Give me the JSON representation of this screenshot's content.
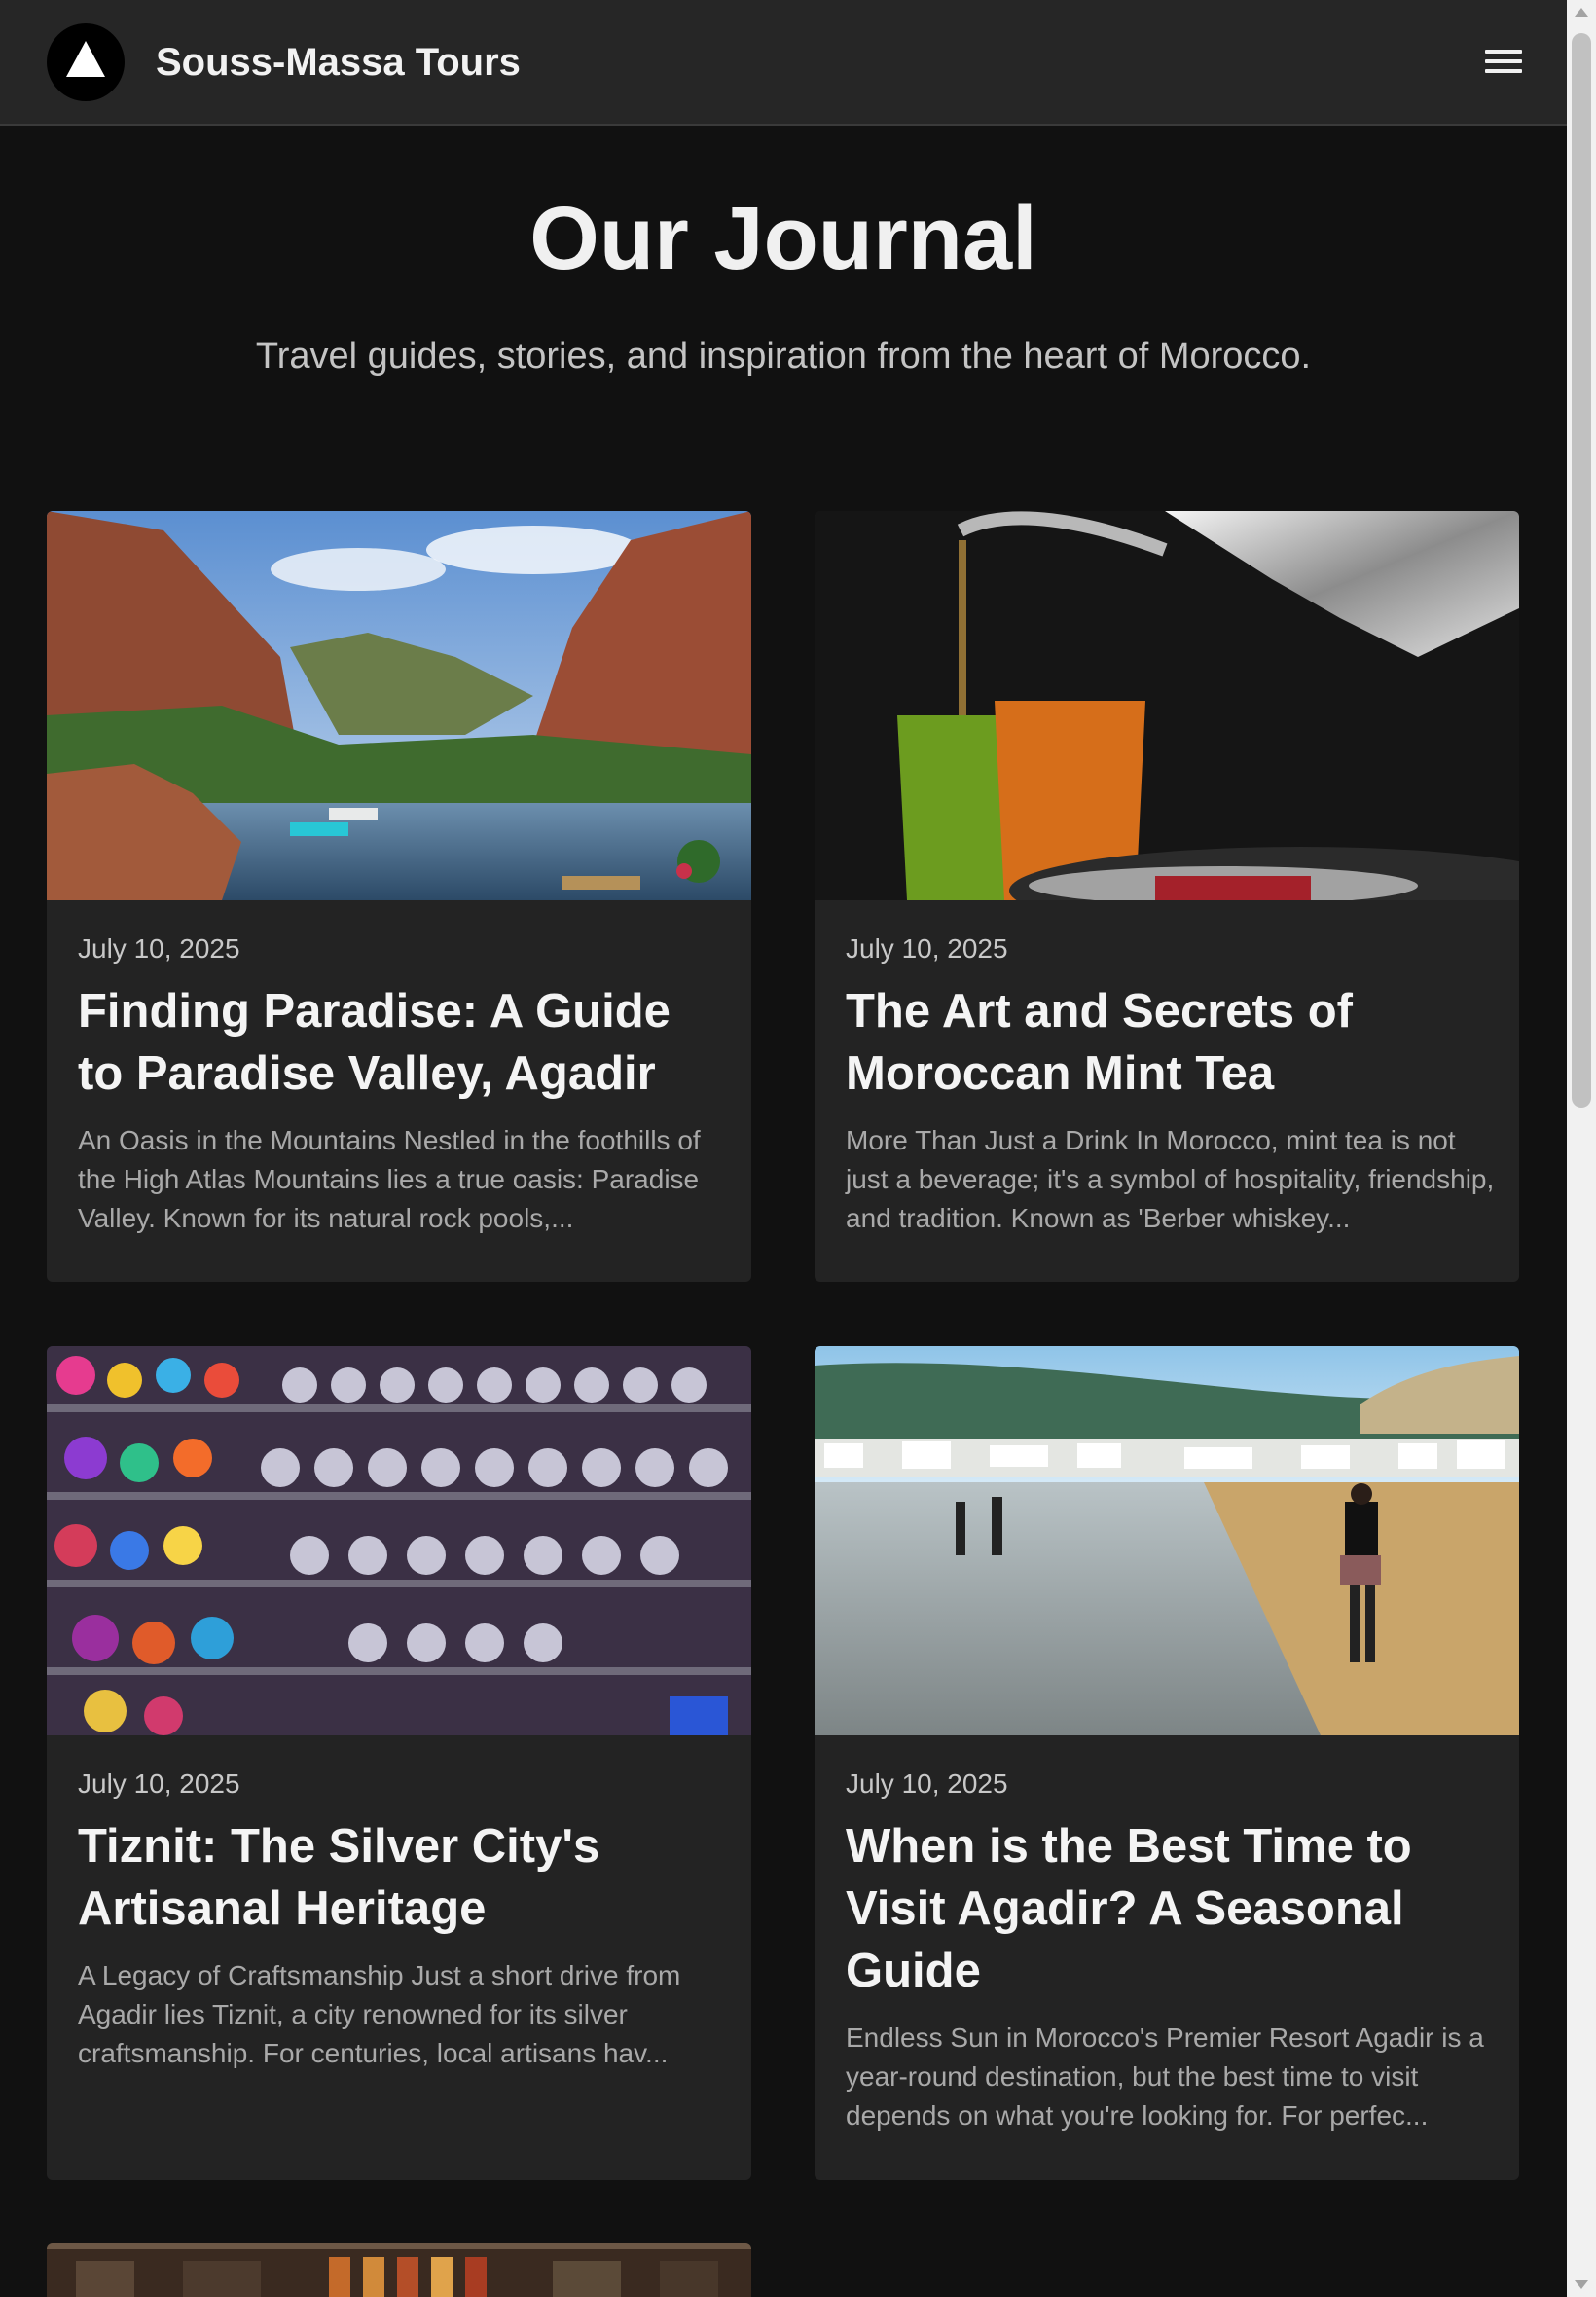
{
  "header": {
    "brand": "Souss-Massa Tours",
    "logo_icon": "mountain-triangle-icon",
    "menu_icon": "hamburger-menu-icon"
  },
  "hero": {
    "title": "Our Journal",
    "subtitle": "Travel guides, stories, and inspiration from the heart of Morocco."
  },
  "posts": [
    {
      "date": "July 10, 2025",
      "title": "Finding Paradise: A Guide to Paradise Valley, Agadir",
      "excerpt": "An Oasis in the Mountains Nestled in the foothills of the High Atlas Mountains lies a true oasis: Paradise Valley. Known for its natural rock pools,...",
      "image": "paradise-valley-photo"
    },
    {
      "date": "July 10, 2025",
      "title": "The Art and Secrets of Moroccan Mint Tea",
      "excerpt": "More Than Just a Drink In Morocco, mint tea is not just a beverage; it's a symbol of hospitality, friendship, and tradition. Known as 'Berber whiskey...",
      "image": "mint-tea-photo"
    },
    {
      "date": "July 10, 2025",
      "title": "Tiznit: The Silver City's Artisanal Heritage",
      "excerpt": "A Legacy of Craftsmanship Just a short drive from Agadir lies Tiznit, a city renowned for its silver craftsmanship. For centuries, local artisans hav...",
      "image": "silver-teapots-photo"
    },
    {
      "date": "July 10, 2025",
      "title": "When is the Best Time to Visit Agadir? A Seasonal Guide",
      "excerpt": "Endless Sun in Morocco's Premier Resort Agadir is a year-round destination, but the best time to visit depends on what you're looking for. For perfec...",
      "image": "agadir-beach-photo"
    },
    {
      "image": "spice-shop-photo"
    }
  ],
  "colors": {
    "background": "#111111",
    "header": "#262626",
    "card": "#232323"
  }
}
